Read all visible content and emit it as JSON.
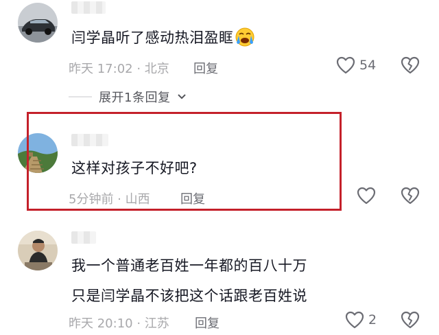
{
  "comments": [
    {
      "text": "闫学晶听了感动热泪盈眶",
      "emoji": "crying-face-emoji",
      "time": "昨天 17:02",
      "location": "北京",
      "reply_label": "回复",
      "likes": "54"
    },
    {
      "text": "这样对孩子不好吧?",
      "time": "5分钟前",
      "location": "山西",
      "reply_label": "回复",
      "likes": ""
    },
    {
      "text_lines": [
        "我一个普通老百姓一年都的百八十万",
        "只是闫学晶不该把这个话跟老百姓说"
      ],
      "time": "昨天 20:10",
      "location": "江苏",
      "reply_label": "回复",
      "likes": "2"
    }
  ],
  "expand_replies": {
    "label": "展开1条回复"
  },
  "icons": {
    "like": "heart-outline-icon",
    "dislike": "broken-heart-icon",
    "expand": "chevron-down-icon"
  },
  "colors": {
    "highlight": "#c4202a",
    "text": "#161823",
    "meta": "#a8a8ab"
  }
}
